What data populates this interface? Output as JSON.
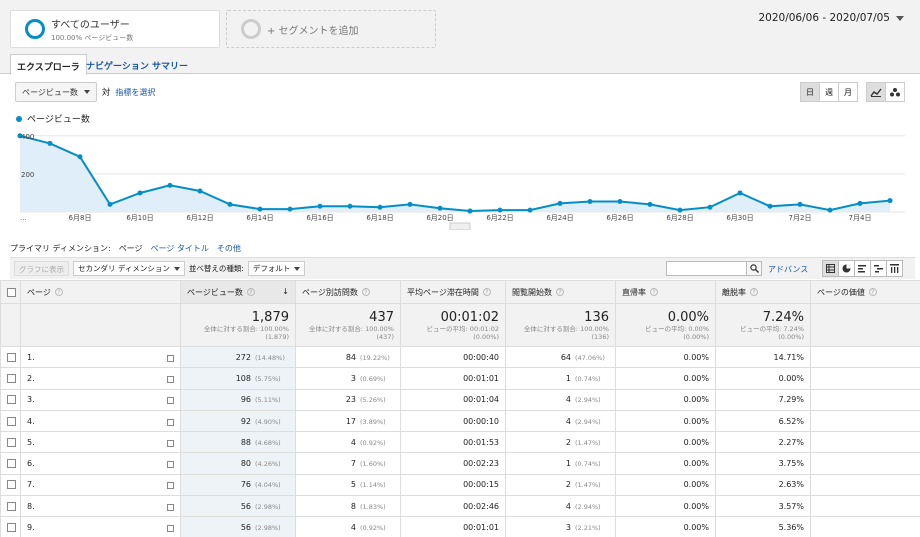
{
  "segments": [
    {
      "title": "すべてのユーザー",
      "subtitle": "100.00% ページビュー数"
    },
    {
      "title": "+ セグメントを追加"
    }
  ],
  "date_range": "2020/06/06 - 2020/07/05",
  "tabs": [
    "エクスプローラ",
    "ナビゲーション サマリー"
  ],
  "metric_selector": {
    "value": "ページビュー数",
    "vs": "対",
    "select_link": "指標を選択"
  },
  "granularity": [
    "日",
    "週",
    "月"
  ],
  "legend": "ページビュー数",
  "chart_data": {
    "type": "area",
    "series": [
      {
        "name": "ページビュー数",
        "values": [
          400,
          360,
          290,
          40,
          100,
          140,
          110,
          40,
          15,
          15,
          30,
          30,
          25,
          40,
          20,
          5,
          10,
          10,
          45,
          55,
          55,
          40,
          10,
          25,
          100,
          30,
          40,
          10,
          45,
          60
        ]
      }
    ],
    "x_labels": [
      "...",
      "6月8日",
      "6月10日",
      "6月12日",
      "6月14日",
      "6月16日",
      "6月18日",
      "6月20日",
      "6月22日",
      "6月24日",
      "6月26日",
      "6月28日",
      "6月30日",
      "7月2日",
      "7月4日"
    ],
    "y_ticks": [
      "400",
      "200"
    ],
    "ylim": [
      0,
      420
    ],
    "color": "#058dc7"
  },
  "primary_dimension": {
    "label": "プライマリ ディメンション:",
    "active": "ページ",
    "other": "ページ タイトル",
    "more": "その他"
  },
  "toolbar": {
    "plot_rows": "グラフに表示",
    "secondary": "セカンダリ ディメンション",
    "sort_label": "並べ替えの種類:",
    "sort_value": "デフォルト",
    "advanced": "アドバンス"
  },
  "columns": [
    "ページ",
    "ページビュー数",
    "ページ別訪問数",
    "平均ページ滞在時間",
    "閲覧開始数",
    "直帰率",
    "離脱率",
    "ページの価値"
  ],
  "totals": [
    {
      "value": "1,879",
      "sub1": "全体に対する割合: 100.00%",
      "sub2": "(1,879)"
    },
    {
      "value": "437",
      "sub1": "全体に対する割合: 100.00%",
      "sub2": "(437)"
    },
    {
      "value": "00:01:02",
      "sub1": "ビューの平均: 00:01:02",
      "sub2": "(0.00%)"
    },
    {
      "value": "136",
      "sub1": "全体に対する割合: 100.00%",
      "sub2": "(136)"
    },
    {
      "value": "0.00%",
      "sub1": "ビューの平均: 0.00%",
      "sub2": "(0.00%)"
    },
    {
      "value": "7.24%",
      "sub1": "ビューの平均: 7.24%",
      "sub2": "(0.00%)"
    }
  ],
  "rows": [
    {
      "n": "1.",
      "pv": "272",
      "pvp": "(14.48%)",
      "vis": "84",
      "visp": "(19.22%)",
      "time": "00:00:40",
      "ent": "64",
      "entp": "(47.06%)",
      "bounce": "0.00%",
      "exit": "14.71%"
    },
    {
      "n": "2.",
      "pv": "108",
      "pvp": "(5.75%)",
      "vis": "3",
      "visp": "(0.69%)",
      "time": "00:01:01",
      "ent": "1",
      "entp": "(0.74%)",
      "bounce": "0.00%",
      "exit": "0.00%"
    },
    {
      "n": "3.",
      "pv": "96",
      "pvp": "(5.11%)",
      "vis": "23",
      "visp": "(5.26%)",
      "time": "00:01:04",
      "ent": "4",
      "entp": "(2.94%)",
      "bounce": "0.00%",
      "exit": "7.29%"
    },
    {
      "n": "4.",
      "pv": "92",
      "pvp": "(4.90%)",
      "vis": "17",
      "visp": "(3.89%)",
      "time": "00:00:10",
      "ent": "4",
      "entp": "(2.94%)",
      "bounce": "0.00%",
      "exit": "6.52%"
    },
    {
      "n": "5.",
      "pv": "88",
      "pvp": "(4.68%)",
      "vis": "4",
      "visp": "(0.92%)",
      "time": "00:01:53",
      "ent": "2",
      "entp": "(1.47%)",
      "bounce": "0.00%",
      "exit": "2.27%"
    },
    {
      "n": "6.",
      "pv": "80",
      "pvp": "(4.26%)",
      "vis": "7",
      "visp": "(1.60%)",
      "time": "00:02:23",
      "ent": "1",
      "entp": "(0.74%)",
      "bounce": "0.00%",
      "exit": "3.75%"
    },
    {
      "n": "7.",
      "pv": "76",
      "pvp": "(4.04%)",
      "vis": "5",
      "visp": "(1.14%)",
      "time": "00:00:15",
      "ent": "2",
      "entp": "(1.47%)",
      "bounce": "0.00%",
      "exit": "2.63%"
    },
    {
      "n": "8.",
      "pv": "56",
      "pvp": "(2.98%)",
      "vis": "8",
      "visp": "(1.83%)",
      "time": "00:02:46",
      "ent": "4",
      "entp": "(2.94%)",
      "bounce": "0.00%",
      "exit": "3.57%"
    },
    {
      "n": "9.",
      "pv": "56",
      "pvp": "(2.98%)",
      "vis": "4",
      "visp": "(0.92%)",
      "time": "00:01:01",
      "ent": "3",
      "entp": "(2.21%)",
      "bounce": "0.00%",
      "exit": "5.36%"
    }
  ]
}
